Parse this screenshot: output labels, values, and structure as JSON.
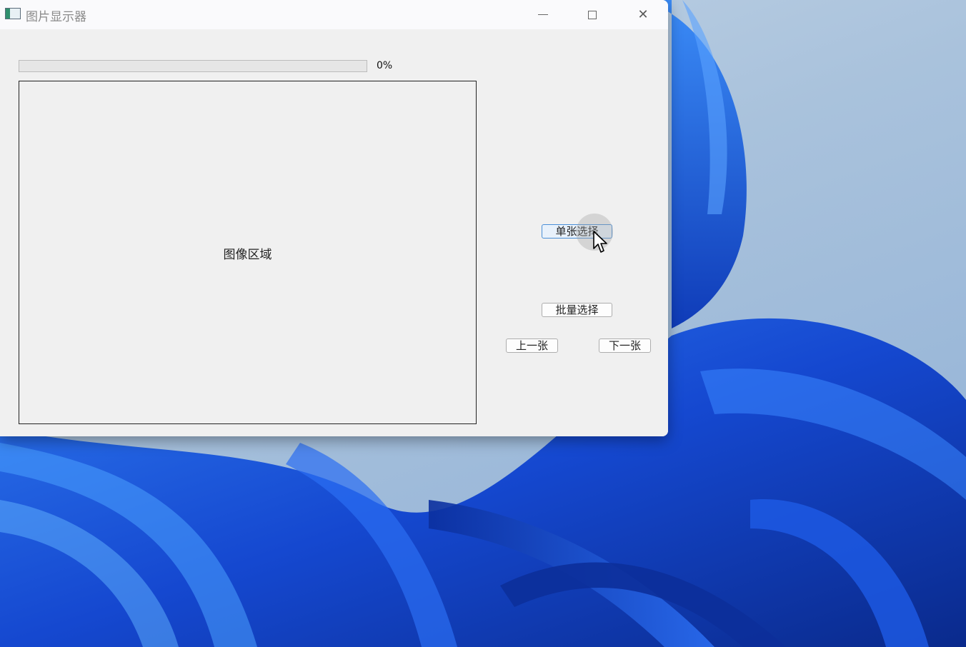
{
  "window": {
    "title": "图片显示器",
    "icon": "app-window-icon",
    "controls": {
      "minimize_icon": "minimize-icon",
      "maximize_icon": "maximize-icon",
      "close_icon": "close-icon",
      "close_glyph": "✕"
    }
  },
  "progress": {
    "value": 0,
    "label": "0%"
  },
  "image_area": {
    "placeholder": "图像区域"
  },
  "buttons": {
    "single_select": "单张选择",
    "batch_select": "批量选择",
    "previous": "上一张",
    "next": "下一张"
  },
  "colors": {
    "accent": "#4a8fd8",
    "wallpaper_blue": "#1a4fd6"
  }
}
